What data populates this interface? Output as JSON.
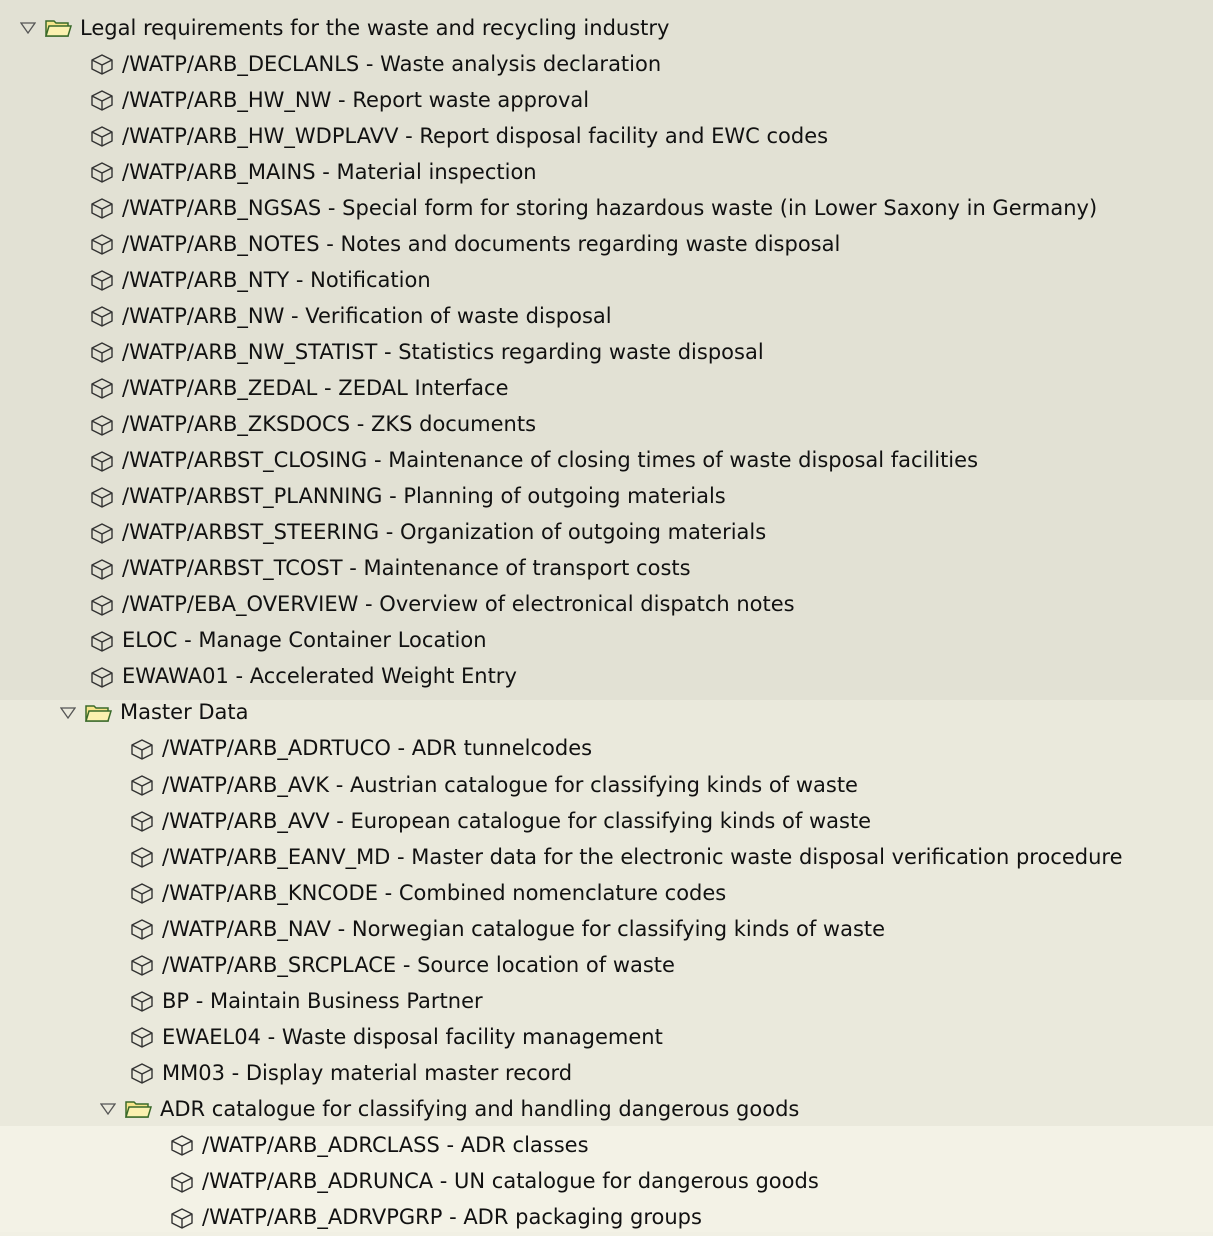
{
  "tree": {
    "root": {
      "label": "Legal requirements for the waste and recycling industry",
      "items": [
        "/WATP/ARB_DECLANLS - Waste analysis declaration",
        "/WATP/ARB_HW_NW - Report waste approval",
        "/WATP/ARB_HW_WDPLAVV - Report disposal facility and EWC codes",
        "/WATP/ARB_MAINS - Material inspection",
        "/WATP/ARB_NGSAS - Special form for storing hazardous waste (in Lower Saxony in Germany)",
        "/WATP/ARB_NOTES - Notes and documents regarding waste disposal",
        "/WATP/ARB_NTY - Notification",
        "/WATP/ARB_NW - Verification of waste disposal",
        "/WATP/ARB_NW_STATIST - Statistics regarding waste disposal",
        "/WATP/ARB_ZEDAL - ZEDAL Interface",
        "/WATP/ARB_ZKSDOCS - ZKS documents",
        "/WATP/ARBST_CLOSING - Maintenance of closing times of waste disposal facilities",
        "/WATP/ARBST_PLANNING - Planning of outgoing materials",
        "/WATP/ARBST_STEERING - Organization of outgoing materials",
        "/WATP/ARBST_TCOST - Maintenance of transport costs",
        "/WATP/EBA_OVERVIEW - Overview of electronical dispatch notes",
        "ELOC - Manage Container Location",
        "EWAWA01 - Accelerated Weight Entry"
      ]
    },
    "master_data": {
      "label": "Master Data",
      "items": [
        "/WATP/ARB_ADRTUCO - ADR tunnelcodes",
        "/WATP/ARB_AVK - Austrian catalogue for classifying kinds of waste",
        "/WATP/ARB_AVV - European catalogue for classifying kinds of waste",
        "/WATP/ARB_EANV_MD - Master data for the electronic waste disposal verification procedure",
        "/WATP/ARB_KNCODE - Combined nomenclature codes",
        "/WATP/ARB_NAV - Norwegian catalogue for classifying kinds of waste",
        "/WATP/ARB_SRCPLACE - Source location of waste",
        "BP - Maintain Business Partner",
        "EWAEL04 - Waste disposal facility management",
        "MM03 - Display material master record"
      ]
    },
    "adr": {
      "label": "ADR catalogue for classifying and handling dangerous goods",
      "items": [
        "/WATP/ARB_ADRCLASS - ADR classes",
        "/WATP/ARB_ADRUNCA - UN catalogue for dangerous goods",
        "/WATP/ARB_ADRVPGRP - ADR packaging groups"
      ]
    }
  }
}
